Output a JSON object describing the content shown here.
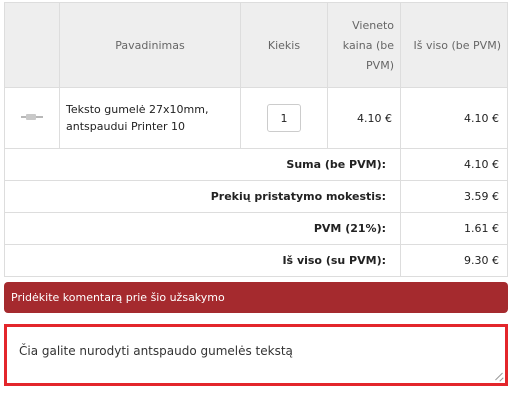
{
  "table": {
    "headers": {
      "image": "",
      "name": "Pavadinimas",
      "quantity": "Kiekis",
      "unit_price_line1": "Vieneto",
      "unit_price_line2": "kaina (be",
      "unit_price_line3": "PVM)",
      "total": "Iš viso (be PVM)"
    },
    "product": {
      "name_line1": "Teksto gumelė 27x10mm,",
      "name_line2": "antspaudui Printer 10",
      "quantity": "1",
      "unit_price": "4.10 €",
      "total": "4.10 €"
    },
    "totals": [
      {
        "label": "Suma (be PVM):",
        "value": "4.10 €"
      },
      {
        "label": "Prekių pristatymo mokestis:",
        "value": "3.59 €"
      },
      {
        "label": "PVM (21%):",
        "value": "1.61 €"
      },
      {
        "label": "Iš viso (su PVM):",
        "value": "9.30 €"
      }
    ]
  },
  "comment": {
    "section_title": "Pridėkite komentarą prie šio užsakymo",
    "text": "Čia galite nurodyti antspaudo gumelės tekstą"
  },
  "colors": {
    "header_bg": "#eeeeee",
    "comment_bar": "#a52a2e",
    "comment_border": "#e3262b"
  },
  "icons": {
    "product_thumbnail": "stamp-rubber-thumbnail"
  }
}
